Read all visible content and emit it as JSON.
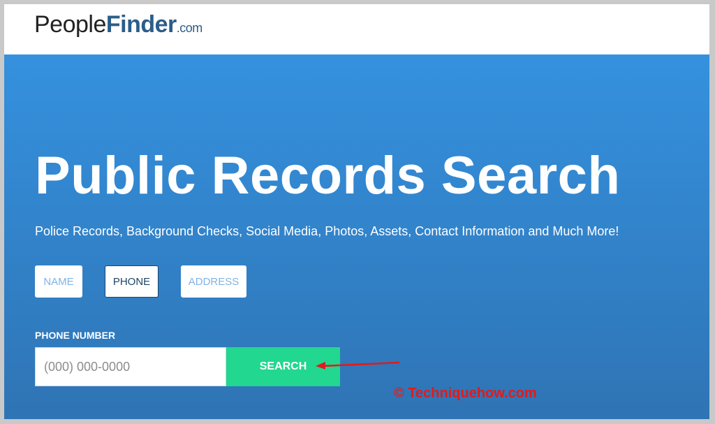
{
  "logo": {
    "part1": "People",
    "part2": "Finder",
    "part3": ".com"
  },
  "hero": {
    "title": "Public Records Search",
    "subtitle": "Police Records, Background Checks, Social Media, Photos, Assets, Contact Information and Much More!"
  },
  "search_tabs": [
    {
      "label": "NAME",
      "active": false
    },
    {
      "label": "PHONE",
      "active": true
    },
    {
      "label": "ADDRESS",
      "active": false
    }
  ],
  "phone_search": {
    "label": "PHONE NUMBER",
    "placeholder": "(000) 000-0000",
    "value": "",
    "button_label": "SEARCH"
  },
  "annotation": {
    "arrow_color": "#e21a1a",
    "watermark": "© Techniquehow.com"
  },
  "colors": {
    "hero_bg": "#3389d4",
    "search_button": "#22d78f",
    "brand": "#2a5d8a"
  }
}
